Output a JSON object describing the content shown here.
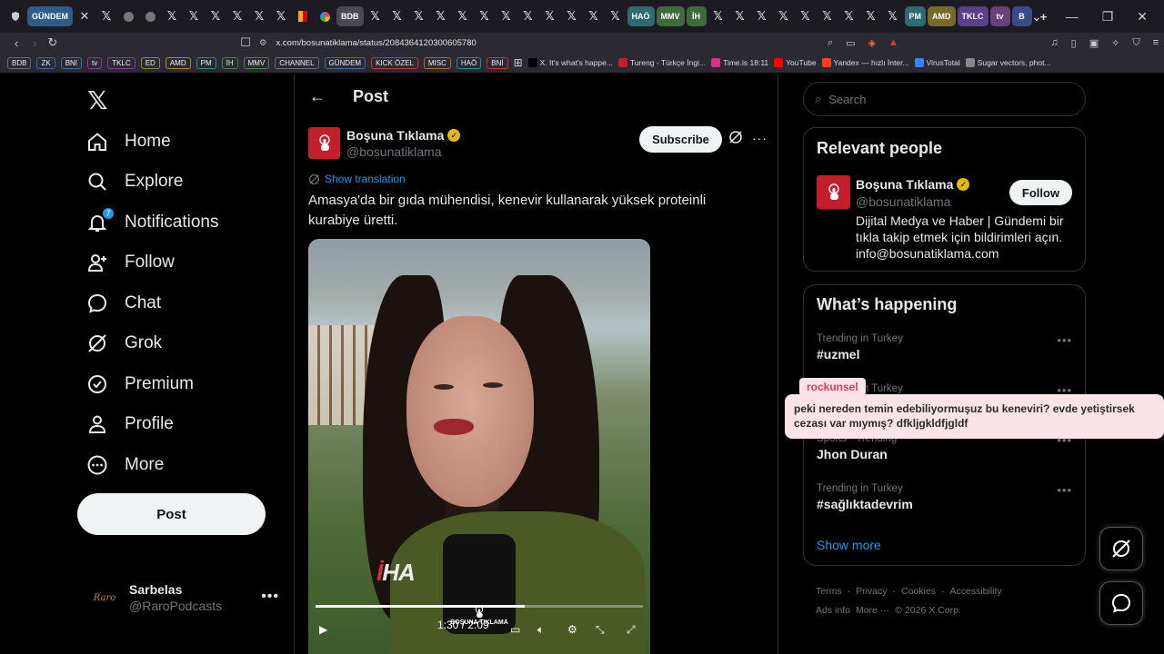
{
  "browser": {
    "tabs": [
      {
        "label": "GÜNDEM",
        "kind": "pill",
        "color": "#2c5d8a"
      },
      {
        "label": "✕",
        "kind": "x"
      },
      {
        "label": "𝕏",
        "kind": "x"
      },
      {
        "label": "",
        "kind": "circle-gray"
      },
      {
        "label": "",
        "kind": "circle-gray"
      },
      {
        "label": "𝕏",
        "kind": "x"
      },
      {
        "label": "𝕏",
        "kind": "x"
      },
      {
        "label": "𝕏",
        "kind": "x"
      },
      {
        "label": "𝕏",
        "kind": "x"
      },
      {
        "label": "𝕏",
        "kind": "x"
      },
      {
        "label": "𝕏",
        "kind": "x"
      },
      {
        "label": "",
        "kind": "flag"
      },
      {
        "label": "",
        "kind": "circle-g"
      },
      {
        "label": "BDB",
        "kind": "pill",
        "color": "#4a4a55"
      },
      {
        "label": "𝕏",
        "kind": "x"
      },
      {
        "label": "𝕏",
        "kind": "x"
      },
      {
        "label": "𝕏",
        "kind": "x"
      },
      {
        "label": "𝕏",
        "kind": "x"
      },
      {
        "label": "𝕏",
        "kind": "x"
      },
      {
        "label": "𝕏",
        "kind": "x"
      },
      {
        "label": "𝕏",
        "kind": "x"
      },
      {
        "label": "𝕏",
        "kind": "x"
      },
      {
        "label": "𝕏",
        "kind": "x"
      },
      {
        "label": "𝕏",
        "kind": "x"
      },
      {
        "label": "𝕏",
        "kind": "x"
      },
      {
        "label": "𝕏",
        "kind": "x"
      },
      {
        "label": "HAÖ",
        "kind": "pill",
        "color": "#2d6b73"
      },
      {
        "label": "MMV",
        "kind": "pill",
        "color": "#3e6b3a"
      },
      {
        "label": "İH",
        "kind": "pill",
        "color": "#3e6b3a"
      },
      {
        "label": "𝕏",
        "kind": "x"
      },
      {
        "label": "𝕏",
        "kind": "x"
      },
      {
        "label": "𝕏",
        "kind": "x"
      },
      {
        "label": "𝕏",
        "kind": "x"
      },
      {
        "label": "𝕏",
        "kind": "x"
      },
      {
        "label": "𝕏",
        "kind": "x"
      },
      {
        "label": "𝕏",
        "kind": "x"
      },
      {
        "label": "𝕏",
        "kind": "x"
      },
      {
        "label": "𝕏",
        "kind": "x"
      },
      {
        "label": "PM",
        "kind": "pill",
        "color": "#2d6b73"
      },
      {
        "label": "AMD",
        "kind": "pill",
        "color": "#7a6a2a"
      },
      {
        "label": "TKLC",
        "kind": "pill",
        "color": "#5a3f8a"
      },
      {
        "label": "tv",
        "kind": "pill",
        "color": "#6a3f7a"
      },
      {
        "label": "B",
        "kind": "pill",
        "color": "#3a4a8a"
      },
      {
        "label": "+",
        "kind": "x"
      }
    ],
    "url": "x.com/bosunatiklama/status/2084364120300605780",
    "bookmark_pills": [
      "BDB",
      "ZK",
      "BNI",
      "tv",
      "TKLC",
      "ED",
      "AMD",
      "PM",
      "İH",
      "MMV",
      "CHANNEL",
      "GÜNDEM",
      "KICK ÖZEL",
      "MISC",
      "HAÖ",
      "BNİ"
    ],
    "bookmark_pill_colors": [
      "#6a6a75",
      "#3a6aa8",
      "#3a6aa8",
      "#8a3f8a",
      "#8a3f8a",
      "#8a8a3a",
      "#a88a2a",
      "#2d8a8a",
      "#3e8a3a",
      "#3e8a3a",
      "#6a6a75",
      "#3a6aa8",
      "#c0392b",
      "#a86a2a",
      "#2d8a8a",
      "#c0392b"
    ],
    "bookmark_links": [
      {
        "label": "X. It's what's happe...",
        "icon_color": "#000"
      },
      {
        "label": "Tureng - Türkçe İngi...",
        "icon_color": "#c41e2a"
      },
      {
        "label": "Time.is 18:11",
        "icon_color": "#d63384"
      },
      {
        "label": "YouTube",
        "icon_color": "#ff0000"
      },
      {
        "label": "Yandex — hızlı İnter...",
        "icon_color": "#fc3f1d"
      },
      {
        "label": "VirusTotal",
        "icon_color": "#3b82f6"
      },
      {
        "label": "Sugar vectors, phot...",
        "icon_color": "#888"
      }
    ]
  },
  "x_nav": {
    "items": [
      {
        "label": "Home",
        "icon": "home-icon"
      },
      {
        "label": "Explore",
        "icon": "search-icon"
      },
      {
        "label": "Notifications",
        "icon": "bell-icon",
        "badge": "7"
      },
      {
        "label": "Follow",
        "icon": "add-person-icon"
      },
      {
        "label": "Chat",
        "icon": "chat-icon"
      },
      {
        "label": "Grok",
        "icon": "grok-icon"
      },
      {
        "label": "Premium",
        "icon": "verified-icon"
      },
      {
        "label": "Profile",
        "icon": "person-icon"
      },
      {
        "label": "More",
        "icon": "more-circle-icon"
      }
    ],
    "post_label": "Post",
    "account": {
      "name": "Sarbelas",
      "handle": "@RaroPodcasts",
      "avatar_text": "Raro"
    }
  },
  "post": {
    "header_title": "Post",
    "author_name": "Boşuna Tıklama",
    "author_handle": "@bosunatiklama",
    "subscribe_label": "Subscribe",
    "show_translation": "Show translation",
    "text": "Amasya'da bir gıda mühendisi, kenevir kullanarak yüksek proteinli kurabiye üretti.",
    "video": {
      "time": "1:30 / 2:09",
      "progress": 0.64,
      "watermark_prefix": "İ",
      "watermark_rest": "HA",
      "mic_brand": "BOŞUNA TIKLAMA"
    }
  },
  "right": {
    "search_placeholder": "Search",
    "relevant_title": "Relevant people",
    "relevant_person": {
      "name": "Boşuna Tıklama",
      "handle": "@bosunatiklama",
      "follow_label": "Follow",
      "bio": "Dijital Medya ve Haber | Gündemi bir tıkla takip etmek için bildirimleri açın. info@bosunatiklama.com"
    },
    "happening_title": "What’s happening",
    "trends": [
      {
        "context": "Trending in Turkey",
        "name": "#uzmel"
      },
      {
        "context": "Trending in Turkey",
        "name": ""
      },
      {
        "context": "Sports · Trending",
        "name": "Jhon Duran"
      },
      {
        "context": "Trending in Turkey",
        "name": "#sağlıktadevrim"
      }
    ],
    "show_more": "Show more",
    "footer_line1": [
      "Terms",
      "Privacy",
      "Cookies",
      "Accessibility"
    ],
    "footer_line2": [
      "Ads info",
      "More ···",
      "© 2026 X Corp."
    ]
  },
  "overlay": {
    "username": "rockunsel",
    "message": "peki nereden temin edebiliyormuşuz bu keneviri? evde yetiştirsek cezası var mıymış? dfkljgkldfjgldf"
  }
}
